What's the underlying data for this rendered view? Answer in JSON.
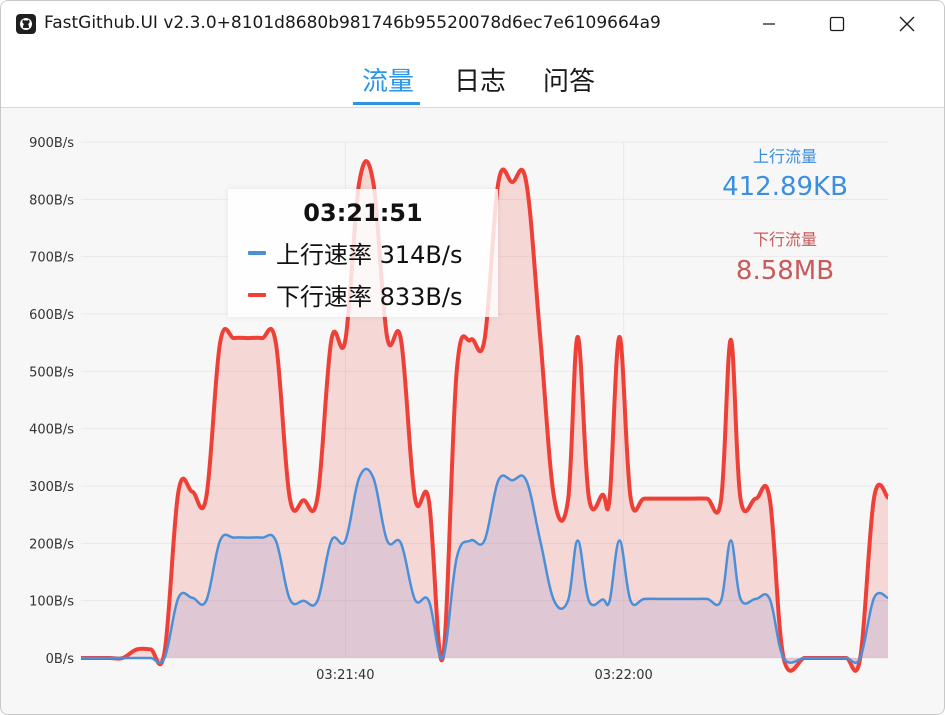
{
  "window": {
    "title": "FastGithub.UI v2.3.0+8101d8680b981746b95520078d6ec7e6109664a9",
    "app_icon": "github-icon",
    "controls": [
      "minimize-icon",
      "maximize-icon",
      "close-icon"
    ]
  },
  "tabs": [
    {
      "label": "流量",
      "active": true
    },
    {
      "label": "日志",
      "active": false
    },
    {
      "label": "问答",
      "active": false
    }
  ],
  "colors": {
    "accent": "#2b96e8",
    "upload": "#4a90d9",
    "download": "#ee4037",
    "upload_stat": "#3c8fe0",
    "download_stat": "#c85a5a"
  },
  "stats": {
    "upload_label": "上行流量",
    "upload_value": "412.89KB",
    "download_label": "下行流量",
    "download_value": "8.58MB"
  },
  "tooltip": {
    "time": "03:21:51",
    "upload": "上行速率 314B/s",
    "download": "下行速率 833B/s"
  },
  "chart_data": {
    "type": "area",
    "title": "",
    "xlabel": "",
    "ylabel": "",
    "ylim": [
      0,
      900
    ],
    "xlim": [
      0,
      58
    ],
    "yticks": [
      "0B/s",
      "100B/s",
      "200B/s",
      "300B/s",
      "400B/s",
      "500B/s",
      "600B/s",
      "700B/s",
      "800B/s",
      "900B/s"
    ],
    "xticks": [
      {
        "x": 19,
        "label": "03:21:40"
      },
      {
        "x": 39,
        "label": "03:22:00"
      }
    ],
    "grid": true,
    "series": [
      {
        "name": "下行速率",
        "points": [
          [
            0,
            0
          ],
          [
            2,
            0
          ],
          [
            3,
            0
          ],
          [
            4,
            15
          ],
          [
            5,
            15
          ],
          [
            6,
            10
          ],
          [
            7,
            290
          ],
          [
            8,
            290
          ],
          [
            9,
            280
          ],
          [
            10,
            550
          ],
          [
            11,
            558
          ],
          [
            12,
            558
          ],
          [
            13,
            558
          ],
          [
            14,
            550
          ],
          [
            15,
            280
          ],
          [
            16,
            275
          ],
          [
            17,
            280
          ],
          [
            18,
            555
          ],
          [
            19,
            555
          ],
          [
            20,
            830
          ],
          [
            21,
            830
          ],
          [
            22,
            560
          ],
          [
            23,
            555
          ],
          [
            24,
            280
          ],
          [
            25,
            275
          ],
          [
            26,
            0
          ],
          [
            27,
            500
          ],
          [
            28,
            555
          ],
          [
            29,
            555
          ],
          [
            30,
            830
          ],
          [
            31,
            830
          ],
          [
            32,
            830
          ],
          [
            33,
            560
          ],
          [
            34,
            280
          ],
          [
            35,
            275
          ],
          [
            35.7,
            560
          ],
          [
            36.5,
            280
          ],
          [
            37.5,
            285
          ],
          [
            38,
            280
          ],
          [
            38.7,
            560
          ],
          [
            39.5,
            280
          ],
          [
            40.5,
            278
          ],
          [
            42,
            278
          ],
          [
            43,
            278
          ],
          [
            44,
            278
          ],
          [
            45,
            278
          ],
          [
            46,
            275
          ],
          [
            46.7,
            555
          ],
          [
            47.4,
            278
          ],
          [
            48.5,
            278
          ],
          [
            49.5,
            278
          ],
          [
            50.5,
            0
          ],
          [
            52,
            0
          ],
          [
            53,
            0
          ],
          [
            54,
            0
          ],
          [
            55,
            0
          ],
          [
            56,
            0
          ],
          [
            57,
            280
          ],
          [
            58,
            280
          ]
        ]
      },
      {
        "name": "上行速率",
        "points": [
          [
            0,
            0
          ],
          [
            2,
            0
          ],
          [
            3,
            0
          ],
          [
            4,
            0
          ],
          [
            5,
            0
          ],
          [
            6,
            0
          ],
          [
            7,
            105
          ],
          [
            8,
            105
          ],
          [
            9,
            100
          ],
          [
            10,
            205
          ],
          [
            11,
            210
          ],
          [
            12,
            210
          ],
          [
            13,
            210
          ],
          [
            14,
            205
          ],
          [
            15,
            103
          ],
          [
            16,
            100
          ],
          [
            17,
            100
          ],
          [
            18,
            205
          ],
          [
            19,
            205
          ],
          [
            20,
            315
          ],
          [
            21,
            315
          ],
          [
            22,
            205
          ],
          [
            23,
            200
          ],
          [
            24,
            102
          ],
          [
            25,
            100
          ],
          [
            26,
            0
          ],
          [
            27,
            175
          ],
          [
            28,
            205
          ],
          [
            29,
            205
          ],
          [
            30,
            310
          ],
          [
            31,
            310
          ],
          [
            32,
            310
          ],
          [
            33,
            205
          ],
          [
            34,
            100
          ],
          [
            35,
            100
          ],
          [
            35.7,
            205
          ],
          [
            36.5,
            100
          ],
          [
            37.5,
            102
          ],
          [
            38,
            100
          ],
          [
            38.7,
            205
          ],
          [
            39.5,
            100
          ],
          [
            40.5,
            103
          ],
          [
            42,
            103
          ],
          [
            43,
            103
          ],
          [
            44,
            103
          ],
          [
            45,
            103
          ],
          [
            46,
            100
          ],
          [
            46.7,
            205
          ],
          [
            47.4,
            103
          ],
          [
            48.5,
            103
          ],
          [
            49.5,
            103
          ],
          [
            50.5,
            0
          ],
          [
            52,
            0
          ],
          [
            53,
            0
          ],
          [
            54,
            0
          ],
          [
            55,
            0
          ],
          [
            56,
            0
          ],
          [
            57,
            105
          ],
          [
            58,
            105
          ]
        ]
      }
    ]
  }
}
